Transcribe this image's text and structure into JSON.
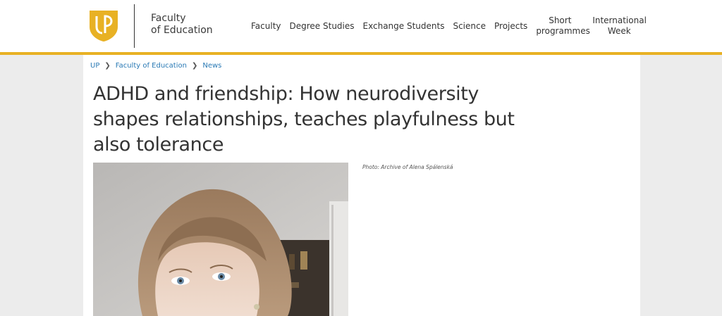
{
  "header": {
    "faculty_line1": "Faculty",
    "faculty_line2": "of Education",
    "logo_icon": "up-shield-logo",
    "accent_color": "#e8b124",
    "nav": [
      {
        "label": "Faculty"
      },
      {
        "label": "Degree Studies"
      },
      {
        "label": "Exchange Students"
      },
      {
        "label": "Science"
      },
      {
        "label": "Projects"
      },
      {
        "label": "Short programmes"
      },
      {
        "label": "International Week"
      }
    ]
  },
  "breadcrumb": {
    "items": [
      "UP",
      "Faculty of Education",
      "News"
    ],
    "separator_icon": "chevron-right-icon"
  },
  "article": {
    "title": "ADHD and friendship: How neurodiversity shapes relationships, teaches playfulness but also tolerance",
    "photo_caption": "Photo: Archive of Alena Spálenská",
    "link_color": "#2a7ab5"
  }
}
